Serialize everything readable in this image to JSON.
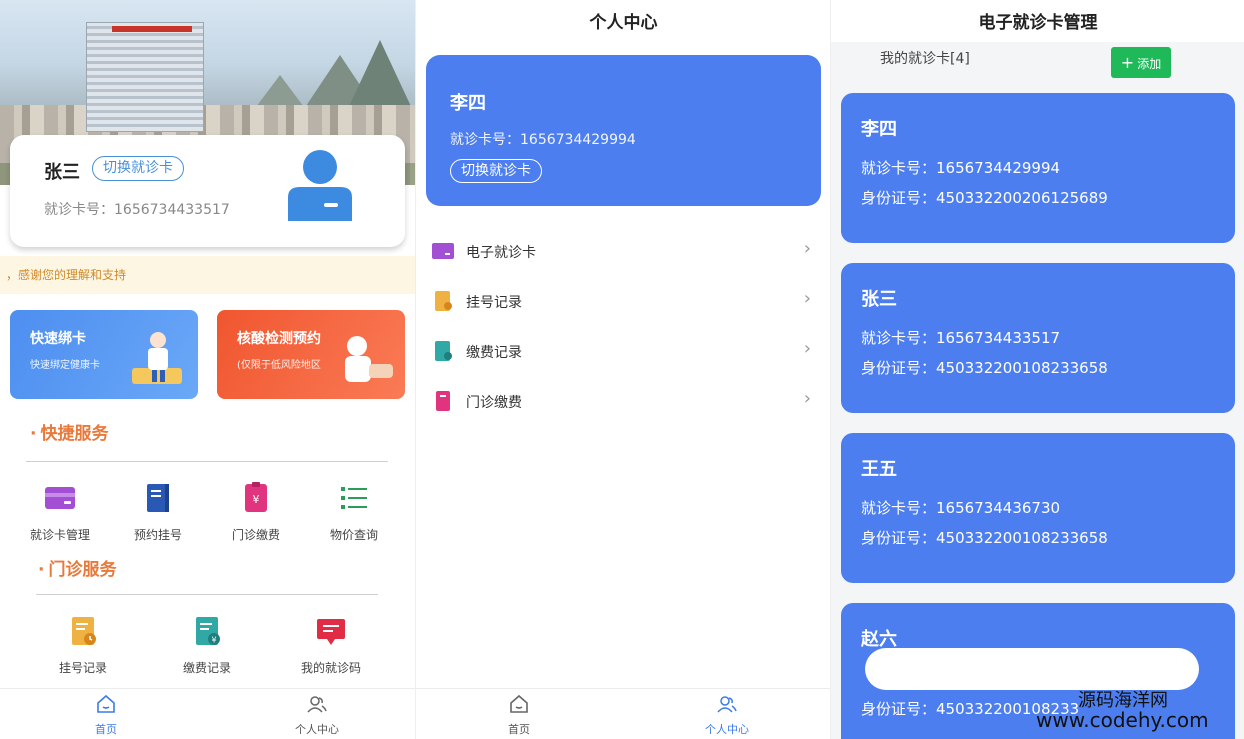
{
  "home": {
    "user_name": "张三",
    "switch_label": "切换就诊卡",
    "card_no_label": "就诊卡号：",
    "card_no": "1656734433517",
    "notice": "，感谢您的理解和支持",
    "banners": [
      {
        "title": "快速绑卡",
        "subtitle": "快速绑定健康卡"
      },
      {
        "title": "核酸检测预约",
        "subtitle": "(仅限于低风险地区"
      }
    ],
    "section_quick": "快捷服务",
    "quick_items": [
      {
        "label": "就诊卡管理",
        "icon": "card-icon"
      },
      {
        "label": "预约挂号",
        "icon": "book-icon"
      },
      {
        "label": "门诊缴费",
        "icon": "payment-icon"
      },
      {
        "label": "物价查询",
        "icon": "list-icon"
      }
    ],
    "section_outpatient": "门诊服务",
    "outpatient_items": [
      {
        "label": "挂号记录",
        "icon": "register-record-icon"
      },
      {
        "label": "缴费记录",
        "icon": "payment-record-icon"
      },
      {
        "label": "我的就诊码",
        "icon": "code-icon"
      }
    ]
  },
  "tabs": [
    {
      "label": "首页",
      "icon": "home-icon"
    },
    {
      "label": "个人中心",
      "icon": "user-icon"
    }
  ],
  "profile": {
    "title": "个人中心",
    "name": "李四",
    "card_text": "就诊卡号：1656734429994",
    "switch_label": "切换就诊卡",
    "menu": [
      {
        "label": "电子就诊卡",
        "icon": "card-icon"
      },
      {
        "label": "挂号记录",
        "icon": "register-record-icon"
      },
      {
        "label": "缴费记录",
        "icon": "payment-record-icon"
      },
      {
        "label": "门诊缴费",
        "icon": "payment-icon"
      }
    ],
    "arrow": "›"
  },
  "cards_page": {
    "title": "电子就诊卡管理",
    "count_text": "我的就诊卡[4]",
    "add_label": "添加",
    "cards": [
      {
        "name": "李四",
        "card_line": "就诊卡号：1656734429994",
        "id_line": "身份证号：450332200206125689"
      },
      {
        "name": "张三",
        "card_line": "就诊卡号：1656734433517",
        "id_line": "身份证号：450332200108233658"
      },
      {
        "name": "王五",
        "card_line": "就诊卡号：1656734436730",
        "id_line": "身份证号：450332200108233658"
      },
      {
        "name": "赵六",
        "card_line": "",
        "id_line": "身份证号：450332200108233"
      }
    ]
  },
  "watermark": {
    "brand": "源码海洋网",
    "url": "www.codehy.com"
  },
  "colors": {
    "primary": "#4c7ef0",
    "accent": "#e8793a",
    "green": "#1fb95a"
  }
}
